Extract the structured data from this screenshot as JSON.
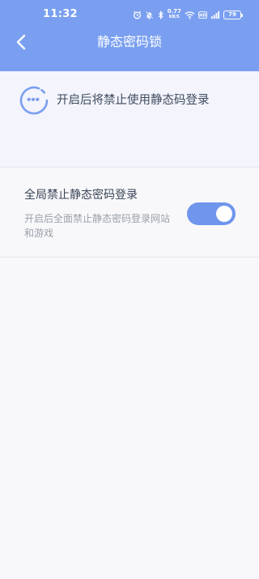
{
  "status_bar": {
    "time": "11:32",
    "net_speed_value": "0.77",
    "net_speed_unit": "KB/S",
    "battery": "79"
  },
  "header": {
    "title": "静态密码锁"
  },
  "notice": {
    "text": "开启后将禁止使用静态码登录"
  },
  "setting": {
    "title": "全局禁止静态密码登录",
    "description": "开启后全面禁止静态密码登录网站和游戏",
    "toggle_on": true
  },
  "colors": {
    "accent": "#7a9ff0",
    "toggle": "#6f95ec",
    "notice_bg": "#f3f4fc",
    "page_bg": "#f8f8fa"
  }
}
